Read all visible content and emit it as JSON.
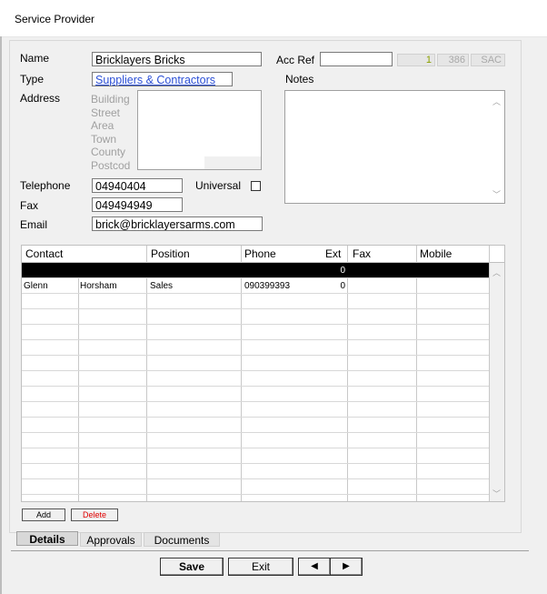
{
  "window": {
    "title": "Service Provider"
  },
  "form": {
    "name_label": "Name",
    "name_value": "Bricklayers Bricks",
    "type_label": "Type",
    "type_value": "Suppliers & Contractors",
    "address_label": "Address",
    "address_parts": [
      "Building",
      "Street",
      "Area",
      "Town",
      "County",
      "Postcod"
    ],
    "telephone_label": "Telephone",
    "telephone_value": "04940404",
    "universal_label": "Universal",
    "fax_label": "Fax",
    "fax_value": "049494949",
    "email_label": "Email",
    "email_value": "brick@bricklayersarms.com",
    "accref_label": "Acc Ref",
    "accref_value": "",
    "code1": "1",
    "code2": "386",
    "code3": "SAC",
    "notes_label": "Notes"
  },
  "grid": {
    "columns": [
      "Contact",
      "Position",
      "Phone",
      "Ext",
      "Fax",
      "Mobile"
    ],
    "rows": [
      {
        "first": "",
        "last": "",
        "position": "",
        "phone": "",
        "ext": "0",
        "fax": "",
        "mobile": ""
      },
      {
        "first": "Glenn",
        "last": "Horsham",
        "position": "Sales",
        "phone": "090399393",
        "ext": "0",
        "fax": "",
        "mobile": ""
      }
    ]
  },
  "grid_buttons": {
    "add": "Add",
    "delete": "Delete"
  },
  "tabs": [
    "Details",
    "Approvals",
    "Documents"
  ],
  "footer": {
    "save": "Save",
    "exit": "Exit",
    "prev": "◀",
    "next": "▶"
  },
  "colors": {
    "link": "#2b4fd6",
    "delete": "#e00000",
    "selected_row": "#000000"
  }
}
